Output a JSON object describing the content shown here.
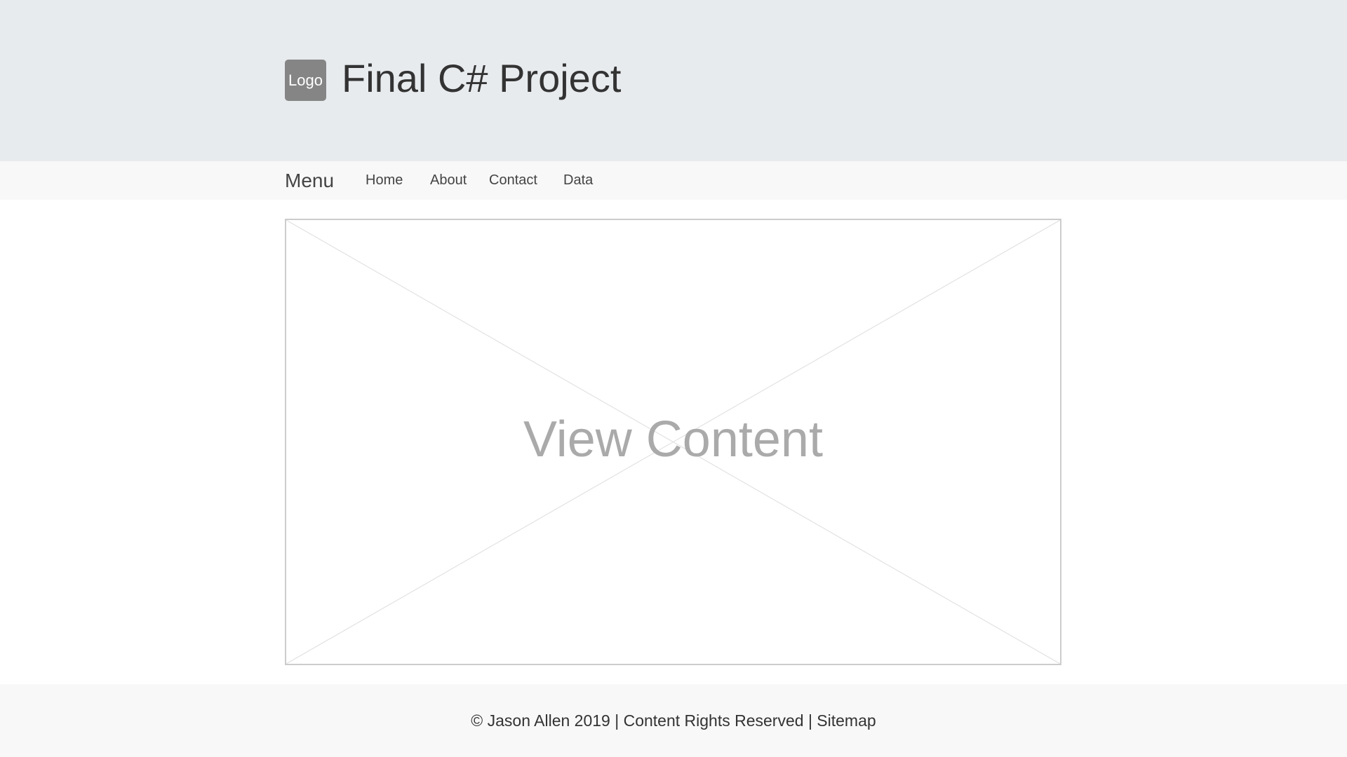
{
  "header": {
    "logo_label": "Logo",
    "title": "Final C# Project"
  },
  "nav": {
    "menu_label": "Menu",
    "items": [
      {
        "label": "Home"
      },
      {
        "label": "About"
      },
      {
        "label": "Contact"
      },
      {
        "label": "Data"
      }
    ]
  },
  "main": {
    "placeholder_label": "View Content"
  },
  "footer": {
    "text": "© Jason Allen 2019 | Content Rights Reserved | Sitemap"
  },
  "colors": {
    "header_bg": "#e8ebee",
    "nav_bg": "#f8f8f8",
    "logo_bg": "#858585",
    "placeholder_text": "#aaaaaa"
  }
}
